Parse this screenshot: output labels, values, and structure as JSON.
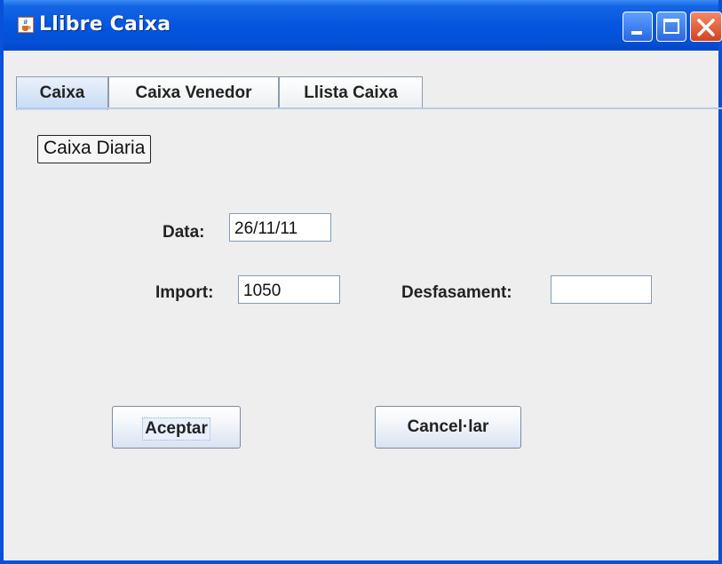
{
  "window": {
    "title": "Llibre Caixa",
    "icon": "java-cup-icon",
    "controls": [
      "minimize-icon",
      "maximize-icon",
      "close-icon"
    ],
    "colors": {
      "titlebar": "#0455df",
      "close": "#d8401c",
      "body": "#eeeeee"
    }
  },
  "tabs": [
    {
      "label": "Caixa",
      "active": true
    },
    {
      "label": "Caixa Venedor",
      "active": false
    },
    {
      "label": "Llista Caixa",
      "active": false
    }
  ],
  "panel": {
    "title": "Caixa Diaria",
    "fields": {
      "data": {
        "label": "Data:",
        "value": "26/11/11"
      },
      "import": {
        "label": "Import:",
        "value": "1050"
      },
      "desfasament": {
        "label": "Desfasament:",
        "value": ""
      }
    },
    "buttons": {
      "accept": "Aceptar",
      "cancel": "Cancel·lar"
    }
  }
}
